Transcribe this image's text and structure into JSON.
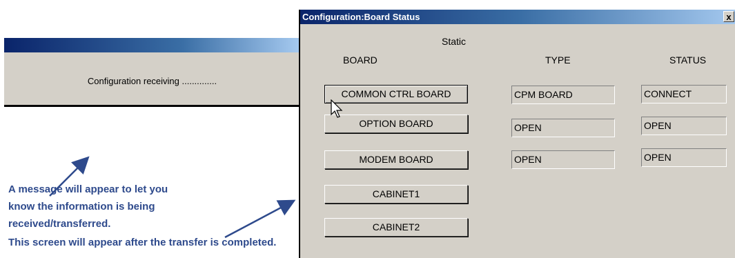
{
  "progress_dialog": {
    "message": "Configuration receiving .............."
  },
  "annotations": {
    "note1": [
      "A message will appear to let you",
      "know the information is being",
      "received/transferred."
    ],
    "note2": "This screen will appear after the transfer is completed."
  },
  "board_window": {
    "title": "Configuration:Board Status",
    "close_glyph": "x",
    "static_label": "Static",
    "headers": {
      "board": "BOARD",
      "type": "TYPE",
      "status": "STATUS"
    },
    "rows": [
      {
        "board": "COMMON CTRL BOARD",
        "type": "CPM BOARD",
        "status": "CONNECT"
      },
      {
        "board": "OPTION BOARD",
        "type": "OPEN",
        "status": "OPEN"
      },
      {
        "board": "MODEM BOARD",
        "type": "OPEN",
        "status": "OPEN"
      },
      {
        "board": "CABINET1"
      },
      {
        "board": "CABINET2"
      }
    ]
  },
  "colors": {
    "annotation": "#2e4a8c",
    "titlebar_dark": "#0a246a",
    "dialog_face": "#d4d0c8"
  }
}
